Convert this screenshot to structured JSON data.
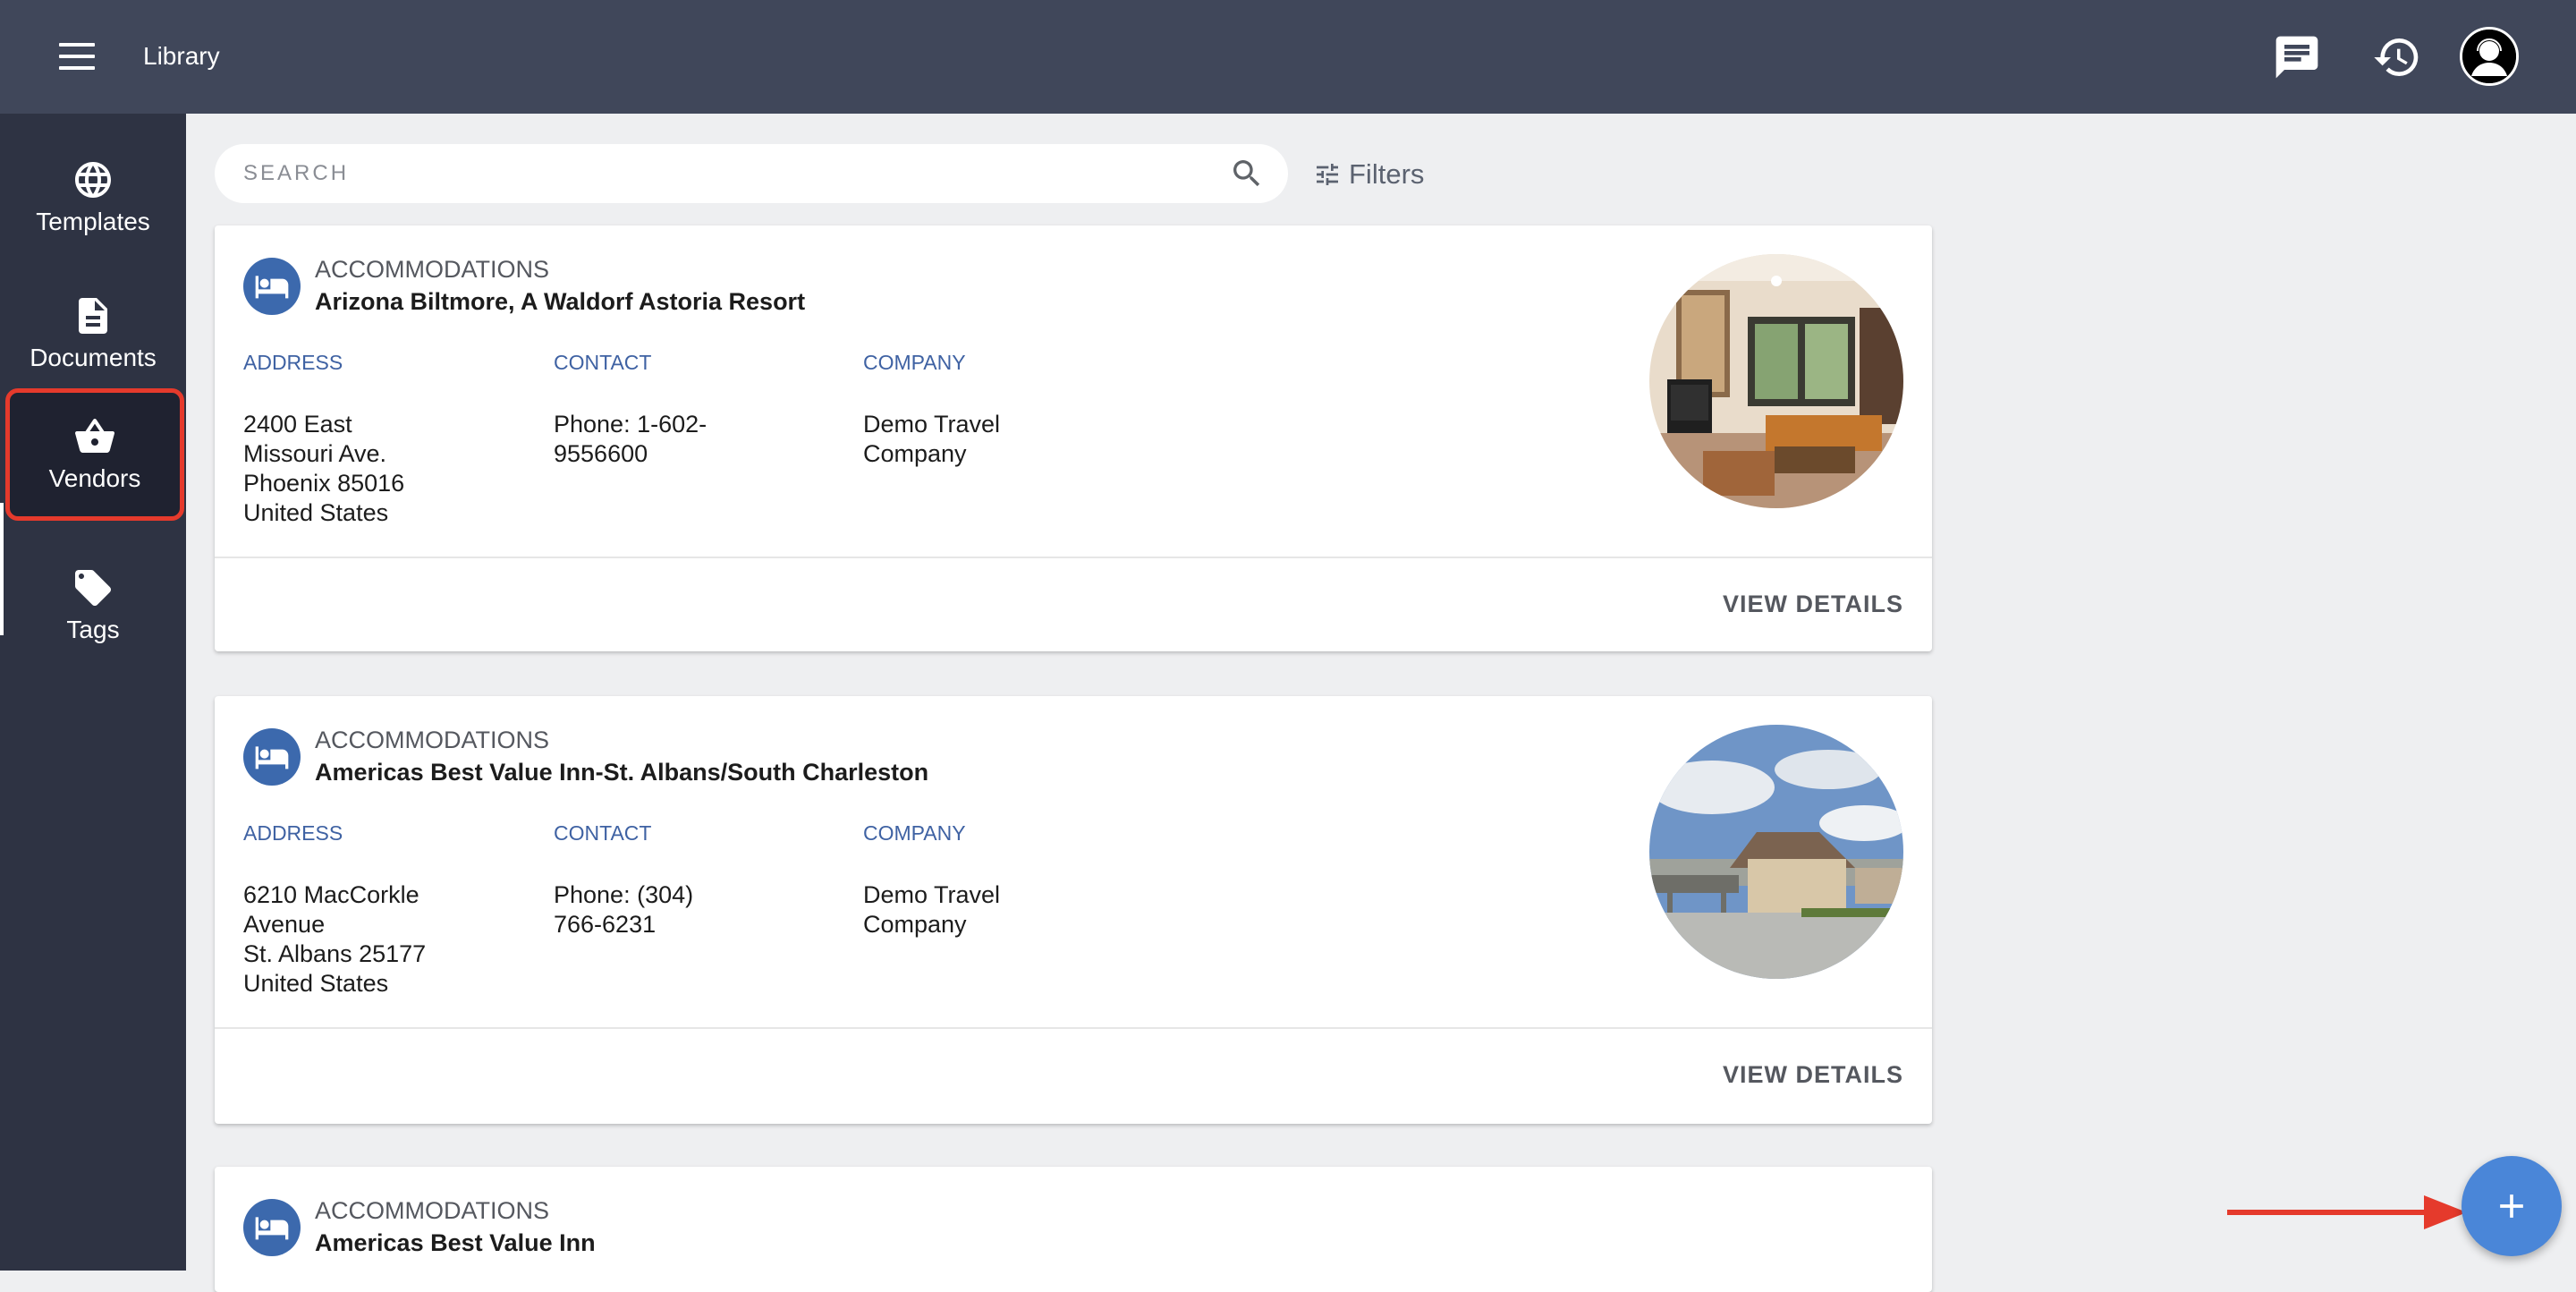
{
  "header": {
    "title": "Library",
    "icons": [
      "menu-icon",
      "chat-icon",
      "history-icon",
      "user-avatar"
    ]
  },
  "sidebar": {
    "items": [
      {
        "label": "Templates",
        "icon": "globe-icon"
      },
      {
        "label": "Documents",
        "icon": "document-icon"
      },
      {
        "label": "Vendors",
        "icon": "basket-icon",
        "active": true
      },
      {
        "label": "Tags",
        "icon": "tag-icon"
      }
    ]
  },
  "search": {
    "placeholder": "SEARCH",
    "filters_label": "Filters"
  },
  "vendors": [
    {
      "category": "ACCOMMODATIONS",
      "name": "Arizona Biltmore, A Waldorf Astoria Resort",
      "address_label": "ADDRESS",
      "address": "2400 East\nMissouri Ave.\nPhoenix 85016\nUnited States",
      "contact_label": "CONTACT",
      "contact": "Phone: 1-602-\n9556600",
      "company_label": "COMPANY",
      "company": "Demo Travel\nCompany",
      "action": "VIEW DETAILS"
    },
    {
      "category": "ACCOMMODATIONS",
      "name": "Americas Best Value Inn-St. Albans/South Charleston",
      "address_label": "ADDRESS",
      "address": "6210 MacCorkle\nAvenue\nSt. Albans 25177\nUnited States",
      "contact_label": "CONTACT",
      "contact": "Phone: (304)\n766-6231",
      "company_label": "COMPANY",
      "company": "Demo Travel\nCompany",
      "action": "VIEW DETAILS"
    },
    {
      "category": "ACCOMMODATIONS",
      "name": "Americas Best Value Inn"
    }
  ],
  "colors": {
    "topbar": "#40475a",
    "sidebar": "#2e3343",
    "accent": "#3c69ad",
    "fab": "#4a86d8",
    "highlight": "#e53a2c"
  }
}
